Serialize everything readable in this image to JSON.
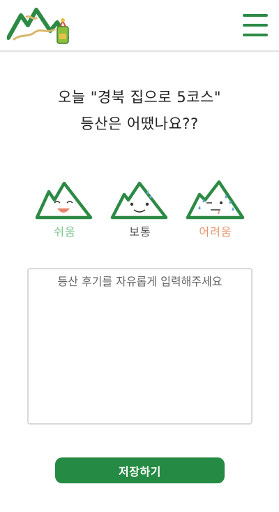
{
  "header": {
    "logo_icon": "mountain-trail-logo",
    "menu_icon": "hamburger-menu-icon"
  },
  "question": {
    "line1": "오늘 \"경북 집으로 5코스\"",
    "line2": "등산은 어땠나요??"
  },
  "ratings": [
    {
      "label": "쉬움",
      "icon": "easy-mountain-icon",
      "color": "#7dc38e"
    },
    {
      "label": "보통",
      "icon": "normal-mountain-icon",
      "color": "#555555"
    },
    {
      "label": "어려움",
      "icon": "hard-mountain-icon",
      "color": "#e8936a"
    }
  ],
  "review": {
    "placeholder": "등산 후기를 자유롭게 입력해주세요",
    "value": ""
  },
  "save_button": {
    "label": "저장하기"
  },
  "colors": {
    "brand_green": "#258a43",
    "divider": "#e2e2e2"
  }
}
